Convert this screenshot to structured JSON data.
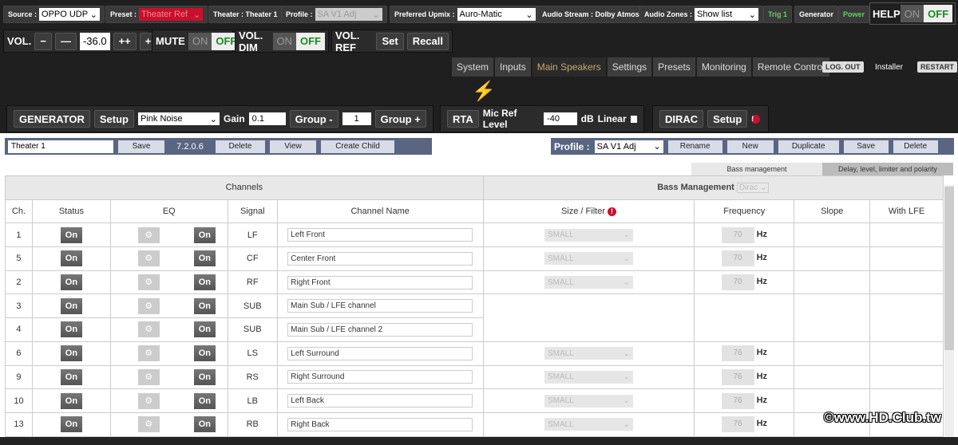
{
  "top": {
    "source_label": "Source :",
    "source": "OPPO UDP",
    "preset_label": "Preset :",
    "preset": "Theater Ref",
    "theater": "Theater : Theater 1",
    "profile_label": "Profile :",
    "profile": "SA V1 Adj",
    "upmix_label": "Preferred Upmix :",
    "upmix": "Auro-Matic",
    "audio_stream": "Audio Stream : Dolby Atmos",
    "zones_label": "Audio Zones :",
    "zones": "Show list",
    "trig": "Trig 1",
    "generator": "Generator",
    "power": "Power",
    "help": "HELP",
    "on": "ON",
    "off": "OFF"
  },
  "vol": {
    "label": "VOL.",
    "minus": "−",
    "minus2": "—",
    "value": "-36.0",
    "plus2": "++",
    "plus": "+",
    "mute": "MUTE",
    "dim": "VOL. DIM",
    "ref": "VOL. REF",
    "set": "Set",
    "recall": "Recall"
  },
  "tabs": [
    "System",
    "Inputs",
    "Main Speakers",
    "Settings",
    "Presets",
    "Monitoring",
    "Remote Control"
  ],
  "account": {
    "logout": "LOG. OUT",
    "user": "Installer",
    "restart": "RESTART"
  },
  "gen": {
    "title": "GENERATOR",
    "setup": "Setup",
    "signal": "Pink Noise",
    "gain_label": "Gain",
    "gain": "0.1",
    "group_minus": "Group -",
    "group": "1",
    "group_plus": "Group +",
    "rta": "RTA",
    "mic_label": "Mic Ref Level",
    "mic": "-40",
    "db": "dB",
    "linear": "Linear",
    "dirac": "DIRAC",
    "dirac_setup": "Setup"
  },
  "theaterbar": {
    "name": "Theater 1",
    "save": "Save",
    "version": "7.2.0.6",
    "delete": "Delete",
    "view": "View",
    "create_child": "Create Child"
  },
  "profilebar": {
    "label": "Profile :",
    "value": "SA V1 Adj",
    "rename": "Rename",
    "new": "New",
    "duplicate": "Duplicate",
    "save": "Save",
    "delete": "Delete"
  },
  "subtabs": [
    "Bass management",
    "Delay, level, limiter and polarity"
  ],
  "table": {
    "channels": "Channels",
    "bass": "Bass Management",
    "bass_mode": "Dirac",
    "headers": [
      "Ch.",
      "Status",
      "EQ",
      "Signal",
      "Channel Name",
      "Size / Filter",
      "Frequency",
      "Slope",
      "With LFE"
    ],
    "on": "On",
    "small": "SMALL",
    "hz": "Hz",
    "rows": [
      {
        "ch": "1",
        "sig": "LF",
        "name": "Left Front",
        "freq": "70"
      },
      {
        "ch": "5",
        "sig": "CF",
        "name": "Center Front",
        "freq": "70"
      },
      {
        "ch": "2",
        "sig": "RF",
        "name": "Right Front",
        "freq": "70"
      },
      {
        "ch": "3",
        "sig": "SUB",
        "name": "Main Sub / LFE channel",
        "freq": null
      },
      {
        "ch": "4",
        "sig": "SUB",
        "name": "Main Sub / LFE channel 2",
        "freq": null
      },
      {
        "ch": "6",
        "sig": "LS",
        "name": "Left Surround",
        "freq": "76"
      },
      {
        "ch": "9",
        "sig": "RS",
        "name": "Right Surround",
        "freq": "76"
      },
      {
        "ch": "10",
        "sig": "LB",
        "name": "Left Back",
        "freq": "76"
      },
      {
        "ch": "13",
        "sig": "RB",
        "name": "Right Back",
        "freq": "76"
      }
    ]
  },
  "watermark": "©www.HD.Club.tw"
}
